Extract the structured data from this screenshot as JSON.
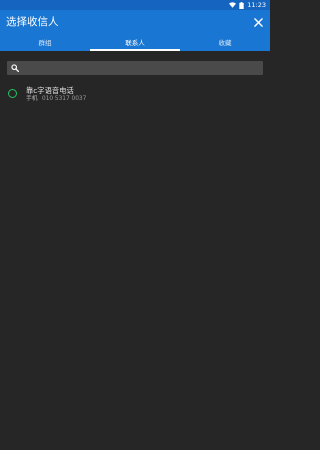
{
  "status_bar": {
    "time": "11:23"
  },
  "app_bar": {
    "title": "选择收信人"
  },
  "tabs": [
    {
      "label": "群组",
      "active": false
    },
    {
      "label": "联系人",
      "active": true
    },
    {
      "label": "收藏",
      "active": false
    }
  ],
  "search": {
    "placeholder": ""
  },
  "contacts": [
    {
      "name": "靠c字语音电话",
      "type": "手机",
      "number": "010 5317 0037",
      "selected": false
    }
  ],
  "colors": {
    "status_bar": "#1565c0",
    "app_bar": "#1976d2",
    "background": "#262626",
    "radio": "#22c55e"
  },
  "icons": [
    "wifi-icon",
    "battery-icon",
    "close-icon",
    "search-icon"
  ]
}
